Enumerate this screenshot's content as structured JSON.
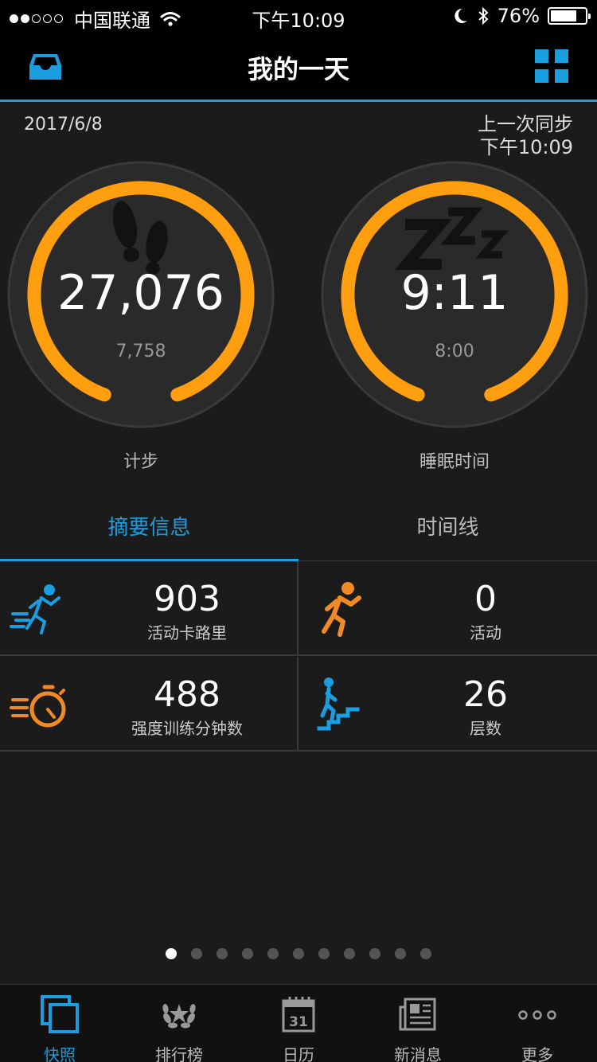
{
  "status_bar": {
    "carrier": "中国联通",
    "time": "下午10:09",
    "battery": "76%",
    "battery_level": 0.76
  },
  "header": {
    "title": "我的一天"
  },
  "date": "2017/6/8",
  "sync": {
    "label": "上一次同步",
    "time": "下午10:09"
  },
  "gauges": [
    {
      "value": "27,076",
      "goal": "7,758",
      "label": "计步",
      "icon": "footprints-icon"
    },
    {
      "value": "9:11",
      "goal": "8:00",
      "label": "睡眠时间",
      "icon": "zzz-sleep-icon"
    }
  ],
  "tabs": [
    {
      "label": "摘要信息",
      "active": true
    },
    {
      "label": "时间线",
      "active": false
    }
  ],
  "stats": [
    {
      "value": "903",
      "label": "活动卡路里",
      "icon": "running-calories-icon",
      "color": "#1a9ee0"
    },
    {
      "value": "0",
      "label": "活动",
      "icon": "running-activity-icon",
      "color": "#f08a24"
    },
    {
      "value": "488",
      "label": "强度训练分钟数",
      "icon": "stopwatch-icon",
      "color": "#f08a24"
    },
    {
      "value": "26",
      "label": "层数",
      "icon": "stairs-icon",
      "color": "#1a9ee0"
    }
  ],
  "pager": {
    "count": 11,
    "current": 0
  },
  "bottom_nav": [
    {
      "label": "快照",
      "icon": "snapshot-icon",
      "active": true
    },
    {
      "label": "排行榜",
      "icon": "laurel-trophy-icon",
      "active": false
    },
    {
      "label": "日历",
      "icon": "calendar-icon",
      "active": false,
      "calendar_day": "31"
    },
    {
      "label": "新消息",
      "icon": "newspaper-icon",
      "active": false
    },
    {
      "label": "更多",
      "icon": "more-icon",
      "active": false
    }
  ],
  "colors": {
    "accent": "#1a9ee0",
    "gauge": "#ff9f0f",
    "orange": "#f08a24",
    "background": "#1b1b1b"
  }
}
